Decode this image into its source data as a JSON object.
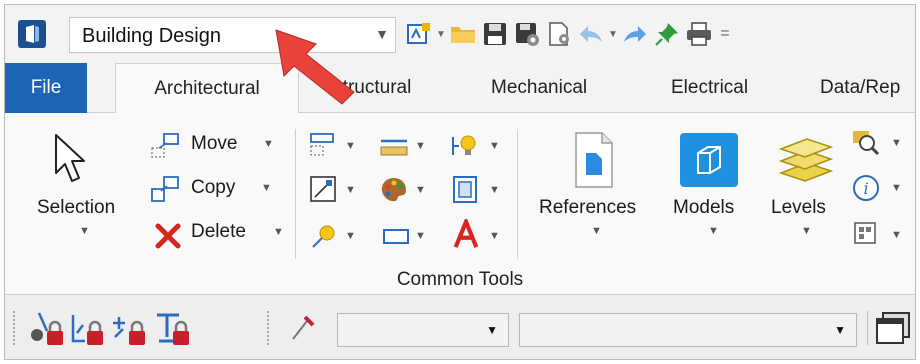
{
  "quick_access": {
    "workspace_value": "Building Design",
    "icons": [
      "workspace-icon",
      "open-folder-icon",
      "save-icon",
      "save-settings-icon",
      "file-properties-icon",
      "undo-icon",
      "redo-icon",
      "pin-icon",
      "print-icon"
    ]
  },
  "tabs": [
    {
      "label": "File"
    },
    {
      "label": "Architectural"
    },
    {
      "label": "Structural"
    },
    {
      "label": "Mechanical"
    },
    {
      "label": "Electrical"
    },
    {
      "label": "Data/Rep"
    }
  ],
  "ribbon": {
    "selection_label": "Selection",
    "move_label": "Move",
    "copy_label": "Copy",
    "delete_label": "Delete",
    "references_label": "References",
    "models_label": "Models",
    "levels_label": "Levels",
    "group_label": "Common Tools"
  },
  "colors": {
    "file_tab": "#1c64b4",
    "models_tile": "#1e90e0",
    "pointer_arrow": "#e8423a"
  }
}
